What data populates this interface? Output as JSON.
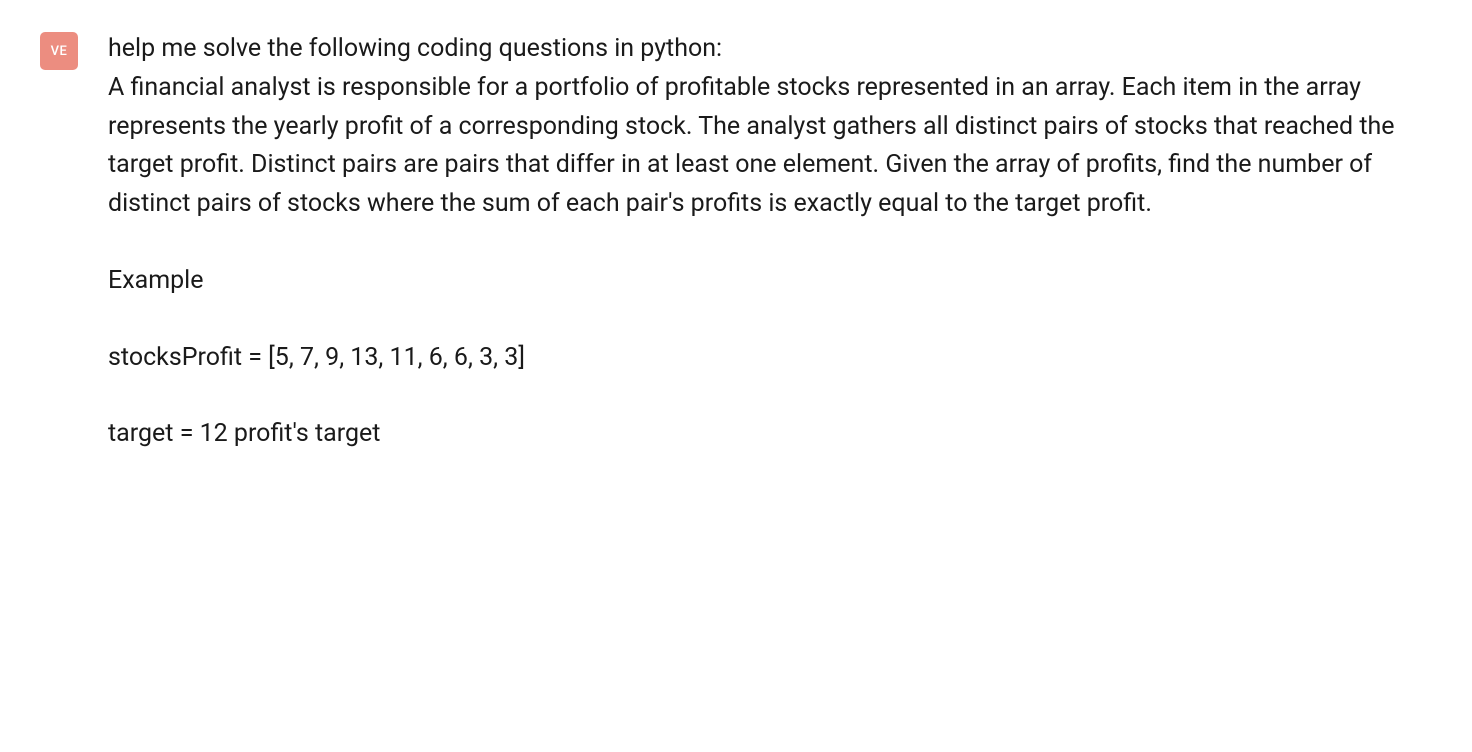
{
  "avatar": {
    "initials": "VE",
    "bgColor": "#ec8d80"
  },
  "message": {
    "intro": "help me solve the following coding questions in python:",
    "problem": "A financial analyst is responsible for a portfolio of profitable stocks represented in an array. Each item in the array represents the yearly profit of a corresponding stock. The analyst gathers all distinct pairs of stocks that reached the target profit. Distinct pairs are pairs that differ in at least one element. Given the array of profits, find the number of distinct pairs of stocks where the sum of each pair's profits is exactly equal to the target profit.",
    "exampleHeader": "Example",
    "exampleLine1": "stocksProfit = [5, 7, 9, 13, 11, 6, 6, 3, 3]",
    "exampleLine2": "target = 12 profit's target"
  }
}
